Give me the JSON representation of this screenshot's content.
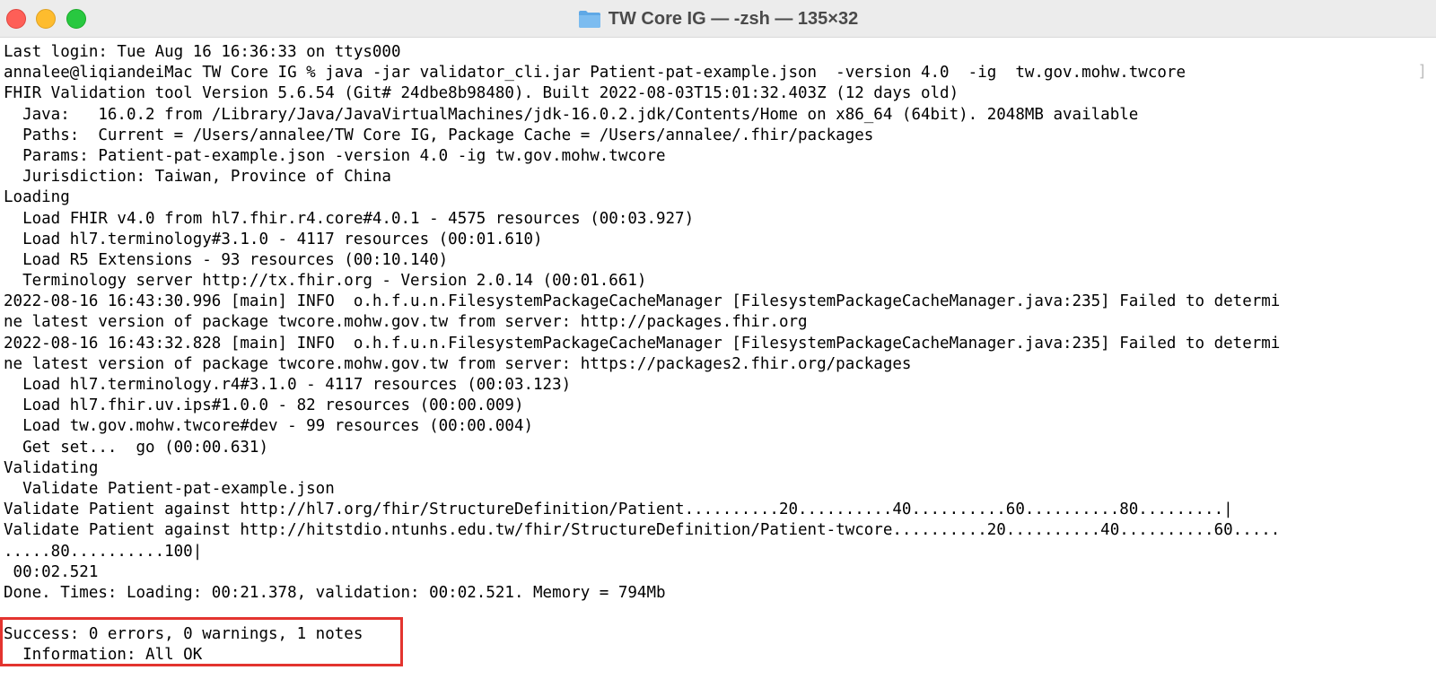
{
  "window": {
    "title": "TW Core IG — -zsh — 135×32",
    "title_icon": "folder-icon",
    "colors": {
      "close": "#fe5f57",
      "minimize": "#febc2e",
      "zoom": "#28c840",
      "highlight": "#e3342f"
    }
  },
  "terminal": {
    "lines": [
      "Last login: Tue Aug 16 16:36:33 on ttys000",
      "annalee@liqiandeiMac TW Core IG % java -jar validator_cli.jar Patient-pat-example.json  -version 4.0  -ig  tw.gov.mohw.twcore",
      "FHIR Validation tool Version 5.6.54 (Git# 24dbe8b98480). Built 2022-08-03T15:01:32.403Z (12 days old)",
      "  Java:   16.0.2 from /Library/Java/JavaVirtualMachines/jdk-16.0.2.jdk/Contents/Home on x86_64 (64bit). 2048MB available",
      "  Paths:  Current = /Users/annalee/TW Core IG, Package Cache = /Users/annalee/.fhir/packages",
      "  Params: Patient-pat-example.json -version 4.0 -ig tw.gov.mohw.twcore",
      "  Jurisdiction: Taiwan, Province of China",
      "Loading",
      "  Load FHIR v4.0 from hl7.fhir.r4.core#4.0.1 - 4575 resources (00:03.927)",
      "  Load hl7.terminology#3.1.0 - 4117 resources (00:01.610)",
      "  Load R5 Extensions - 93 resources (00:10.140)",
      "  Terminology server http://tx.fhir.org - Version 2.0.14 (00:01.661)",
      "2022-08-16 16:43:30.996 [main] INFO  o.h.f.u.n.FilesystemPackageCacheManager [FilesystemPackageCacheManager.java:235] Failed to determi",
      "ne latest version of package twcore.mohw.gov.tw from server: http://packages.fhir.org",
      "2022-08-16 16:43:32.828 [main] INFO  o.h.f.u.n.FilesystemPackageCacheManager [FilesystemPackageCacheManager.java:235] Failed to determi",
      "ne latest version of package twcore.mohw.gov.tw from server: https://packages2.fhir.org/packages",
      "  Load hl7.terminology.r4#3.1.0 - 4117 resources (00:03.123)",
      "  Load hl7.fhir.uv.ips#1.0.0 - 82 resources (00:00.009)",
      "  Load tw.gov.mohw.twcore#dev - 99 resources (00:00.004)",
      "  Get set...  go (00:00.631)",
      "Validating",
      "  Validate Patient-pat-example.json",
      "Validate Patient against http://hl7.org/fhir/StructureDefinition/Patient..........20..........40..........60..........80.........|",
      "Validate Patient against http://hitstdio.ntunhs.edu.tw/fhir/StructureDefinition/Patient-twcore..........20..........40..........60.....",
      ".....80..........100|",
      " 00:02.521",
      "Done. Times: Loading: 00:21.378, validation: 00:02.521. Memory = 794Mb",
      "",
      "Success: 0 errors, 0 warnings, 1 notes",
      "  Information: All OK"
    ],
    "trailing_bracket": "]"
  }
}
